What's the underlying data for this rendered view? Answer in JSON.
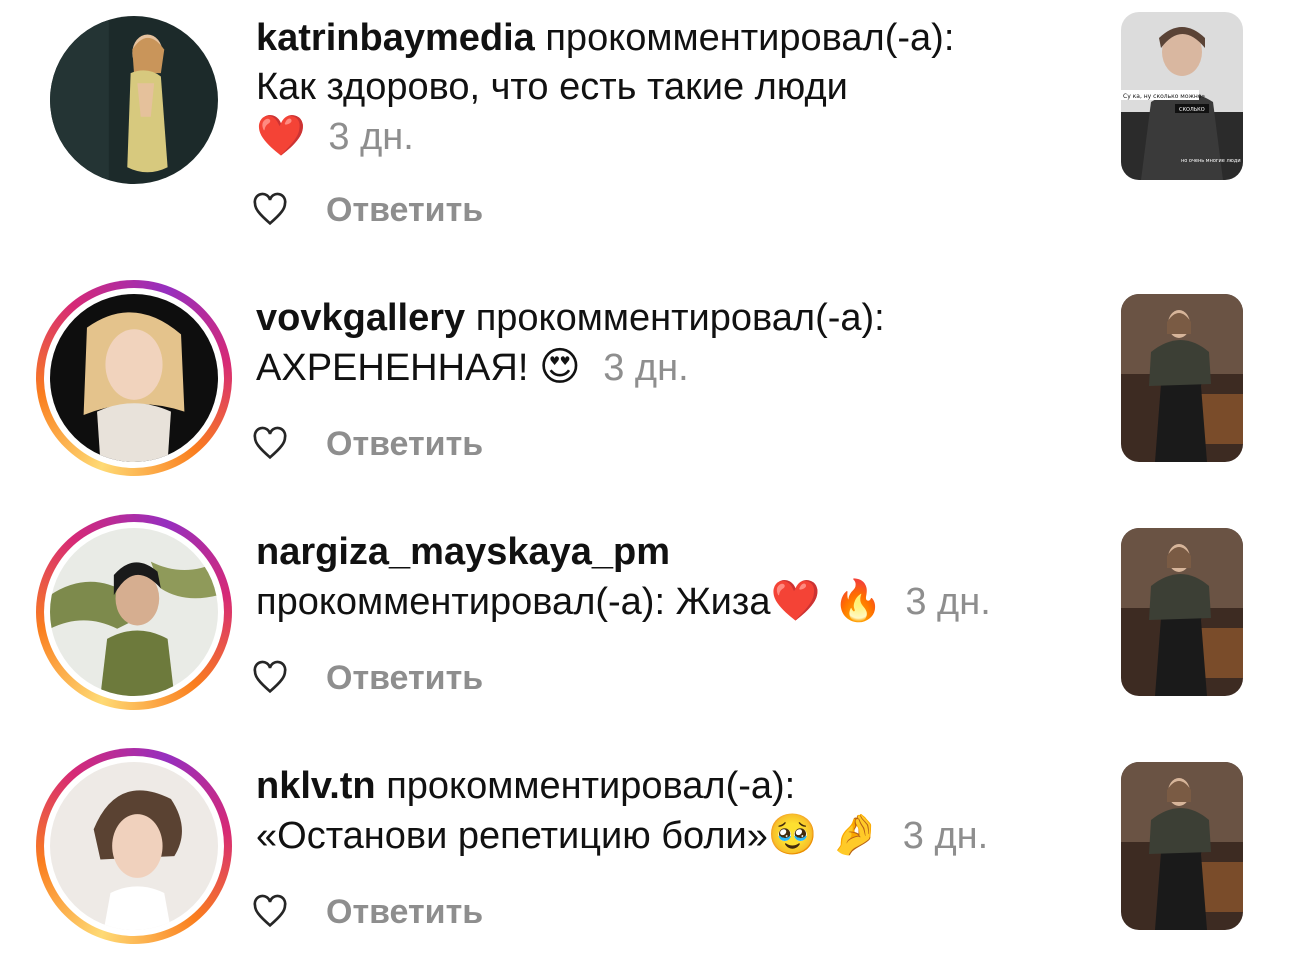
{
  "action_text": "прокомментировал(-а):",
  "reply_label": "Ответить",
  "comments": [
    {
      "username": "katrinbaymedia",
      "text": "Как здорово, что есть такие люди",
      "emoji": "❤️",
      "time": "3 дн.",
      "avatar_icon": "avatar-photo",
      "has_story_ring": false
    },
    {
      "username": "vovkgallery",
      "text": "АХРЕНЕННАЯ!",
      "emoji": "😍",
      "time": "3 дн.",
      "avatar_icon": "avatar-photo",
      "has_story_ring": true
    },
    {
      "username": "nargiza_mayskaya_pm",
      "text": "Жиза",
      "emoji": "❤️ 🔥",
      "time": "3 дн.",
      "avatar_icon": "avatar-photo",
      "has_story_ring": true
    },
    {
      "username": "nklv.tn",
      "text": "«Останови репетицию боли»",
      "emoji": "🥹 🤌",
      "time": "3 дн.",
      "avatar_icon": "avatar-photo",
      "has_story_ring": true
    }
  ],
  "thumbnail_captions": {
    "top": "Су ка, ну сколько можно»",
    "middle": "СКОЛЬКО",
    "bottom": "но очень многие люди"
  },
  "colors": {
    "time_gray": "#8e8e8e",
    "heart_red": "#e0222f",
    "story_ring": [
      "#feda75",
      "#fa7e1e",
      "#d62976",
      "#962fbf"
    ]
  }
}
